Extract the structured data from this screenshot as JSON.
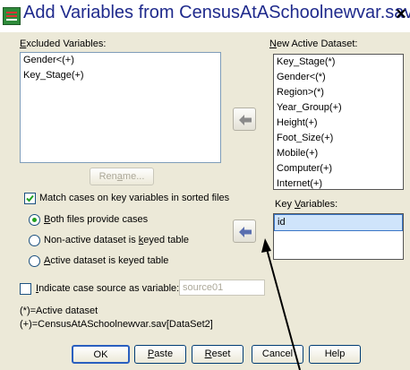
{
  "window": {
    "title": "Add Variables from CensusAtASchoolnewvar.sav[D...",
    "close_glyph": "×"
  },
  "excluded": {
    "label_prefix": "",
    "label_u": "E",
    "label_rest": "xcluded Variables:",
    "items": [
      "Gender<(+)",
      "Key_Stage(+)"
    ]
  },
  "new_active": {
    "label_u": "N",
    "label_rest": "ew Active Dataset:",
    "items": [
      "Key_Stage(*)",
      "Gender<(*)",
      "Region>(*)",
      "Year_Group(+)",
      "Height(+)",
      "Foot_Size(+)",
      "Mobile(+)",
      "Computer(+)",
      "Internet(+)"
    ]
  },
  "key_vars": {
    "label_pre": "Key ",
    "label_u": "V",
    "label_rest": "ariables:",
    "items": [
      "id"
    ]
  },
  "rename": {
    "pre": "Ren",
    "u": "a",
    "rest": "me..."
  },
  "match": {
    "label": "Match cases on key variables in sorted files",
    "checked": true
  },
  "options": {
    "both": {
      "u": "B",
      "rest": "oth files provide cases",
      "selected": true
    },
    "nonactive": {
      "pre": "Non-active dataset is ",
      "u": "k",
      "rest": "eyed table",
      "selected": false
    },
    "active": {
      "u": "A",
      "rest": "ctive dataset is keyed table",
      "selected": false
    }
  },
  "indicate": {
    "u": "I",
    "rest": "ndicate case source as variable:",
    "checked": false,
    "value": "source01"
  },
  "legend": {
    "line1": "(*)=Active dataset",
    "line2": "(+)=CensusAtASchoolnewvar.sav[DataSet2]"
  },
  "buttons": {
    "ok": "OK",
    "paste_u": "P",
    "paste_rest": "aste",
    "reset_u": "R",
    "reset_rest": "eset",
    "cancel": "Cancel",
    "help": "Help"
  },
  "colors": {
    "title_text": "#1f2a8c",
    "dialog_bg": "#ece9d8",
    "arrow_blue": "#5a6fb0",
    "arrow_gray": "#8a8a8a"
  }
}
